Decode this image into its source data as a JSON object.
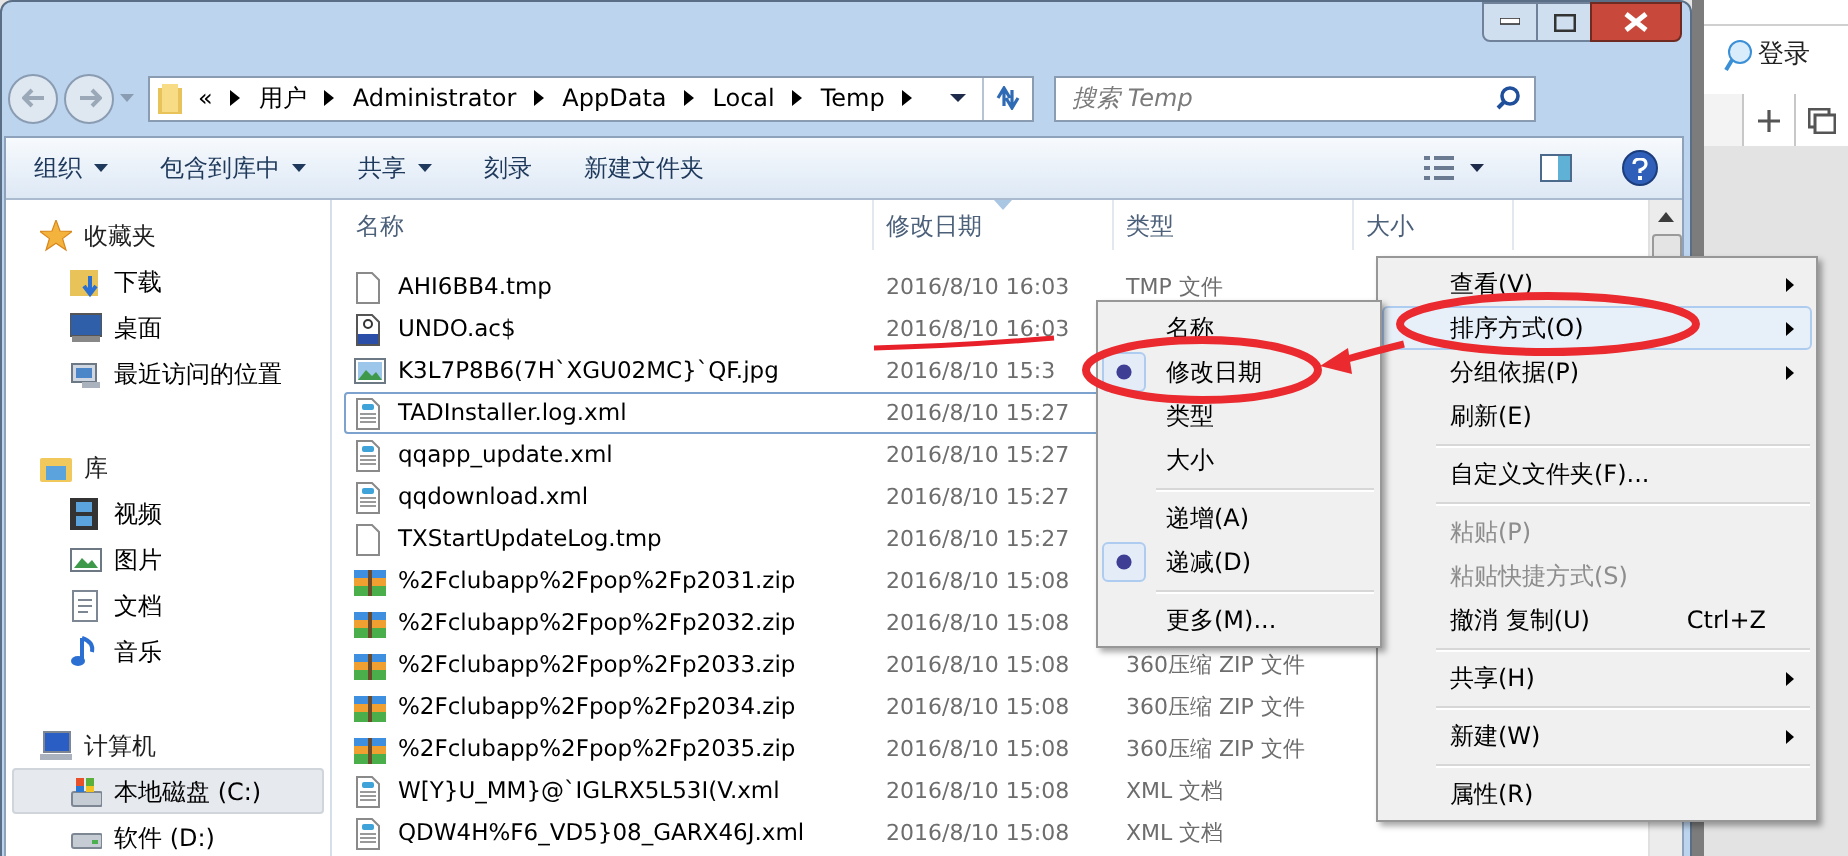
{
  "address_bar": {
    "path": [
      "«",
      "用户",
      "Administrator",
      "AppData",
      "Local",
      "Temp"
    ]
  },
  "search": {
    "placeholder": "搜索 Temp"
  },
  "toolbar": {
    "buttons": [
      {
        "label": "组织",
        "dropdown": true
      },
      {
        "label": "包含到库中",
        "dropdown": true
      },
      {
        "label": "共享",
        "dropdown": true
      },
      {
        "label": "刻录",
        "dropdown": false
      },
      {
        "label": "新建文件夹",
        "dropdown": false
      }
    ]
  },
  "sidebar": {
    "sections": [
      {
        "label": "收藏夹",
        "items": [
          {
            "label": "下载",
            "selected": false
          },
          {
            "label": "桌面",
            "selected": false
          },
          {
            "label": "最近访问的位置",
            "selected": false
          }
        ]
      },
      {
        "label": "库",
        "items": [
          {
            "label": "视频",
            "selected": false
          },
          {
            "label": "图片",
            "selected": false
          },
          {
            "label": "文档",
            "selected": false
          },
          {
            "label": "音乐",
            "selected": false
          }
        ]
      },
      {
        "label": "计算机",
        "items": [
          {
            "label": "本地磁盘 (C:)",
            "selected": true
          },
          {
            "label": "软件 (D:)",
            "selected": false
          }
        ]
      }
    ]
  },
  "table": {
    "columns": [
      {
        "label": "名称",
        "sorted": false
      },
      {
        "label": "修改日期",
        "sorted": true
      },
      {
        "label": "类型",
        "sorted": false
      },
      {
        "label": "大小",
        "sorted": false
      }
    ],
    "rows": [
      {
        "kind": "blank",
        "name": "AHI6BB4.tmp",
        "date": "2016/8/10 16:03",
        "type": "TMP 文件",
        "focused": false
      },
      {
        "kind": "script",
        "name": "UNDO.ac$",
        "date": "2016/8/10 16:03",
        "focused": false
      },
      {
        "kind": "image",
        "name": "K3L7P8B6(7H`XGU02MC}`QF.jpg",
        "date": "2016/8/10 15:3",
        "focused": false
      },
      {
        "kind": "xml",
        "name": "TADInstaller.log.xml",
        "date": "2016/8/10 15:27",
        "focused": true
      },
      {
        "kind": "xml",
        "name": "qqapp_update.xml",
        "date": "2016/8/10 15:27",
        "focused": false
      },
      {
        "kind": "xml",
        "name": "qqdownload.xml",
        "date": "2016/8/10 15:27",
        "focused": false
      },
      {
        "kind": "blank",
        "name": "TXStartUpdateLog.tmp",
        "date": "2016/8/10 15:27",
        "focused": false
      },
      {
        "kind": "zip",
        "name": "%2Fclubapp%2Fpop%2Fp2031.zip",
        "date": "2016/8/10 15:08",
        "focused": false
      },
      {
        "kind": "zip",
        "name": "%2Fclubapp%2Fpop%2Fp2032.zip",
        "date": "2016/8/10 15:08",
        "focused": false
      },
      {
        "kind": "zip",
        "name": "%2Fclubapp%2Fpop%2Fp2033.zip",
        "date": "2016/8/10 15:08",
        "type": "360压缩 ZIP 文件",
        "focused": false
      },
      {
        "kind": "zip",
        "name": "%2Fclubapp%2Fpop%2Fp2034.zip",
        "date": "2016/8/10 15:08",
        "type": "360压缩 ZIP 文件",
        "focused": false
      },
      {
        "kind": "zip",
        "name": "%2Fclubapp%2Fpop%2Fp2035.zip",
        "date": "2016/8/10 15:08",
        "type": "360压缩 ZIP 文件",
        "focused": false
      },
      {
        "kind": "xml",
        "name": "W[Y}U_MM}@`IGLRX5L53I(V.xml",
        "date": "2016/8/10 15:08",
        "type": "XML 文档",
        "focused": false
      },
      {
        "kind": "xml",
        "name": "QDW4H%F6_VD5}08_GARX46J.xml",
        "date": "2016/8/10 15:08",
        "type": "XML 文档",
        "focused": false
      }
    ]
  },
  "context_menu": {
    "items": [
      {
        "kind": "item",
        "label": "查看(V)",
        "submenu": true,
        "highlighted": false,
        "disabled": false
      },
      {
        "kind": "item",
        "label": "排序方式(O)",
        "submenu": true,
        "highlighted": true,
        "disabled": false
      },
      {
        "kind": "item",
        "label": "分组依据(P)",
        "submenu": true,
        "highlighted": false,
        "disabled": false
      },
      {
        "kind": "item",
        "label": "刷新(E)",
        "submenu": false,
        "highlighted": false,
        "disabled": false
      },
      {
        "kind": "separator"
      },
      {
        "kind": "item",
        "label": "自定义文件夹(F)...",
        "submenu": false,
        "highlighted": false,
        "disabled": false
      },
      {
        "kind": "separator"
      },
      {
        "kind": "item",
        "label": "粘贴(P)",
        "submenu": false,
        "highlighted": false,
        "disabled": true
      },
      {
        "kind": "item",
        "label": "粘贴快捷方式(S)",
        "submenu": false,
        "highlighted": false,
        "disabled": true
      },
      {
        "kind": "item",
        "label": "撤消 复制(U)",
        "shortcut": "Ctrl+Z",
        "submenu": false,
        "highlighted": false,
        "disabled": false
      },
      {
        "kind": "separator"
      },
      {
        "kind": "item",
        "label": "共享(H)",
        "submenu": true,
        "highlighted": false,
        "disabled": false
      },
      {
        "kind": "separator"
      },
      {
        "kind": "item",
        "label": "新建(W)",
        "submenu": true,
        "highlighted": false,
        "disabled": false
      },
      {
        "kind": "separator"
      },
      {
        "kind": "item",
        "label": "属性(R)",
        "submenu": false,
        "highlighted": false,
        "disabled": false
      }
    ]
  },
  "sort_submenu": {
    "items": [
      {
        "kind": "item",
        "label": "名称",
        "checked": false
      },
      {
        "kind": "item",
        "label": "修改日期",
        "checked": true
      },
      {
        "kind": "item",
        "label": "类型",
        "checked": false
      },
      {
        "kind": "item",
        "label": "大小",
        "checked": false
      },
      {
        "kind": "separator"
      },
      {
        "kind": "item",
        "label": "递增(A)",
        "checked": false
      },
      {
        "kind": "item",
        "label": "递减(D)",
        "checked": true
      },
      {
        "kind": "separator"
      },
      {
        "kind": "item",
        "label": "更多(M)...",
        "checked": false
      }
    ]
  },
  "background_window": {
    "login_label": "登录"
  }
}
